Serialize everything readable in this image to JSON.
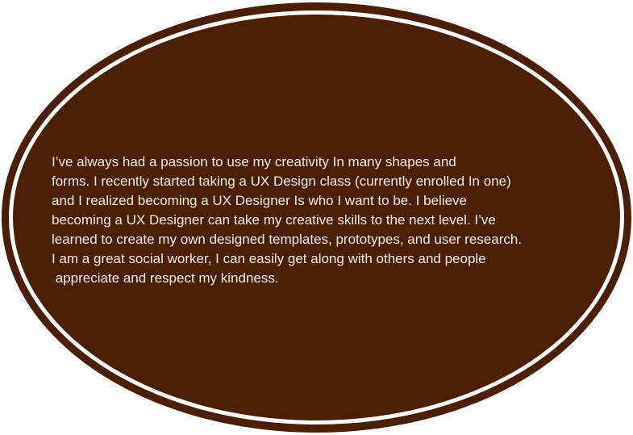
{
  "bio": {
    "lines": [
      "I’ve always had a passion to use my creativity In many shapes and",
      "forms. I recently started taking a UX Design class (currently enrolled In one)",
      "and I realized becoming a UX Designer Is who I want to be. I believe",
      "becoming a UX Designer can take my creative skills to the next level. I’ve",
      "learned to create my own designed templates, prototypes, and user research.",
      "I am a great social worker, I can easily get along with others and people",
      " appreciate and respect my kindness."
    ]
  },
  "colors": {
    "oval_fill": "#4a1f05",
    "ring": "#ffffff",
    "text": "#f3ece6"
  }
}
